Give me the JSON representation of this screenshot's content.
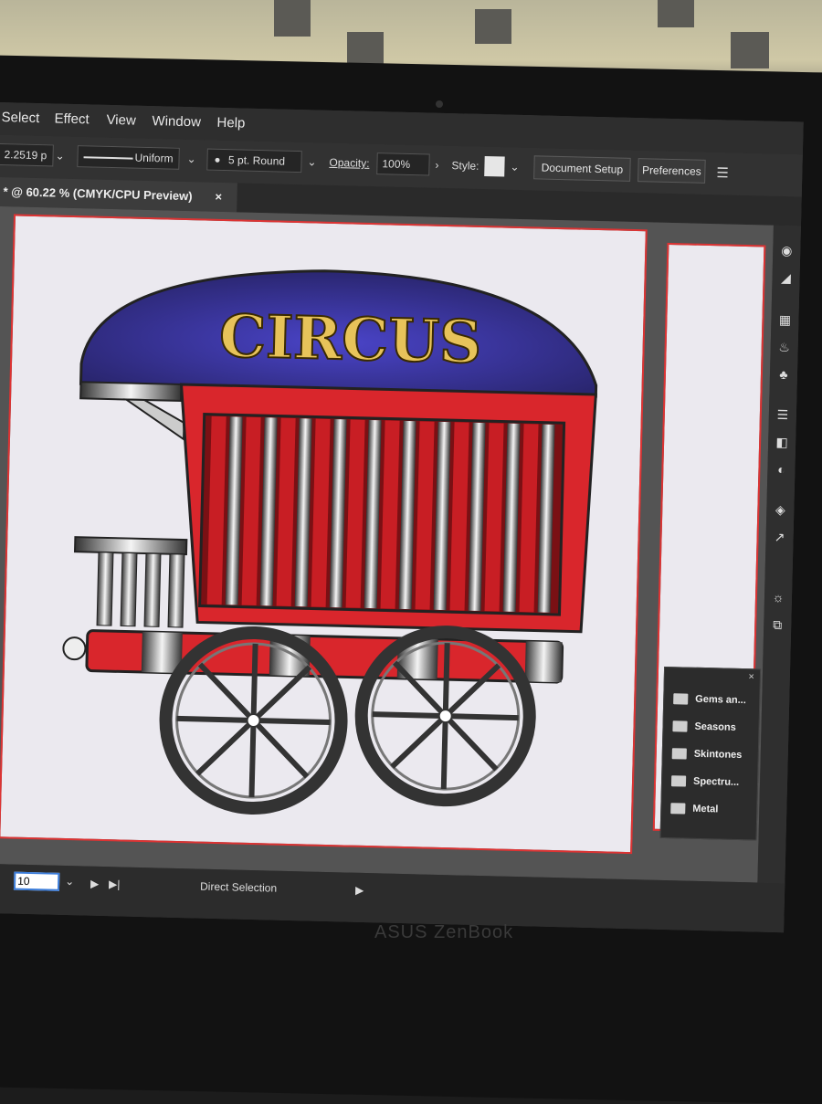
{
  "menu": [
    "Select",
    "Effect",
    "View",
    "Window",
    "Help"
  ],
  "control": {
    "stroke_weight": "2.2519 p",
    "profile": "Uniform",
    "brush": "5 pt. Round",
    "opacity_label": "Opacity:",
    "opacity_value": "100%",
    "style_label": "Style:",
    "doc_setup": "Document Setup",
    "preferences": "Preferences"
  },
  "document_tab": {
    "title": "* @ 60.22 % (CMYK/CPU Preview)",
    "close": "×"
  },
  "artwork": {
    "sign_text": "CIRCUS",
    "colors": {
      "roof": "#3a3592",
      "body": "#d9262c",
      "sign": "#e7c35a",
      "wheel": "#333333"
    }
  },
  "swatch_panel": {
    "items": [
      "Gems an...",
      "Seasons",
      "Skintones",
      "Spectru...",
      "Metal"
    ]
  },
  "status": {
    "page_field": "10",
    "tool_name": "Direct Selection"
  },
  "laptop_brand": "ASUS ZenBook"
}
